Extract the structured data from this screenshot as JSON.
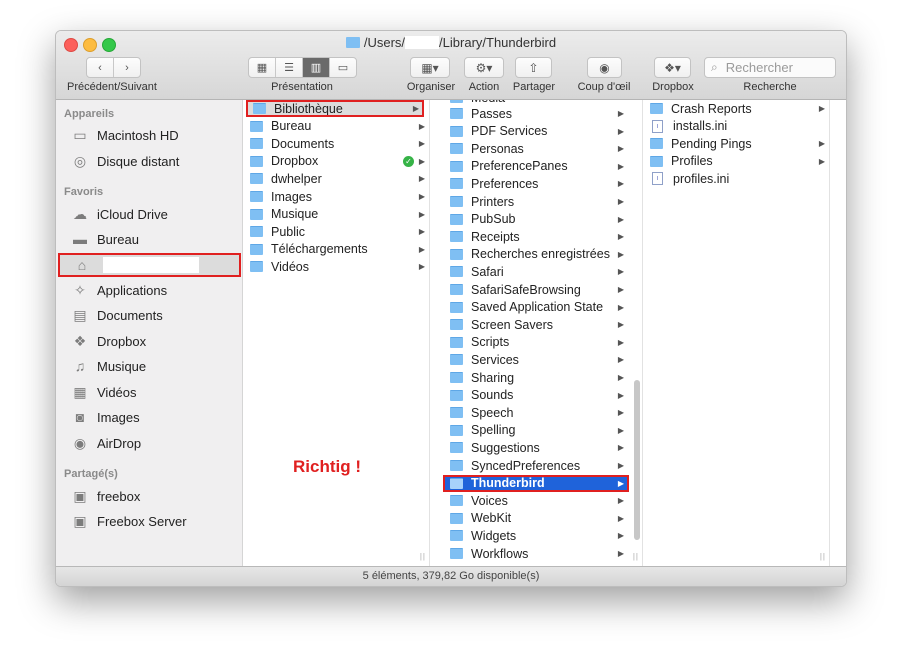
{
  "window": {
    "title_prefix": "/Users/",
    "title_suffix": "/Library/Thunderbird"
  },
  "toolbar": {
    "back_forward_label": "Précédent/Suivant",
    "view_label": "Présentation",
    "organize_label": "Organiser",
    "action_label": "Action",
    "share_label": "Partager",
    "quicklook_label": "Coup d'œil",
    "dropbox_label": "Dropbox",
    "search_label": "Recherche",
    "search_placeholder": "Rechercher"
  },
  "sidebar": {
    "sections": [
      {
        "title": "Appareils",
        "items": [
          {
            "label": "Macintosh HD",
            "icon": "hard-disk-icon"
          },
          {
            "label": "Disque distant",
            "icon": "disc-icon"
          }
        ]
      },
      {
        "title": "Favoris",
        "items": [
          {
            "label": "iCloud Drive",
            "icon": "cloud-icon"
          },
          {
            "label": "Bureau",
            "icon": "desktop-icon"
          },
          {
            "label": "",
            "icon": "home-icon"
          },
          {
            "label": "Applications",
            "icon": "applications-icon"
          },
          {
            "label": "Documents",
            "icon": "document-icon"
          },
          {
            "label": "Dropbox",
            "icon": "dropbox-icon"
          },
          {
            "label": "Musique",
            "icon": "music-icon"
          },
          {
            "label": "Vidéos",
            "icon": "film-icon"
          },
          {
            "label": "Images",
            "icon": "camera-icon"
          },
          {
            "label": "AirDrop",
            "icon": "airdrop-icon"
          }
        ]
      },
      {
        "title": "Partagé(s)",
        "items": [
          {
            "label": "freebox",
            "icon": "monitor-icon"
          },
          {
            "label": "Freebox Server",
            "icon": "monitor-icon"
          }
        ]
      }
    ]
  },
  "column1": [
    "Bibliothèque",
    "Bureau",
    "Documents",
    "Dropbox",
    "dwhelper",
    "Images",
    "Musique",
    "Public",
    "Téléchargements",
    "Vidéos"
  ],
  "column2": [
    "Passes",
    "PDF Services",
    "Personas",
    "PreferencePanes",
    "Preferences",
    "Printers",
    "PubSub",
    "Receipts",
    "Recherches enregistrées",
    "Safari",
    "SafariSafeBrowsing",
    "Saved Application State",
    "Screen Savers",
    "Scripts",
    "Services",
    "Sharing",
    "Sounds",
    "Speech",
    "Spelling",
    "Suggestions",
    "SyncedPreferences",
    "Thunderbird",
    "Voices",
    "WebKit",
    "Widgets",
    "Workflows"
  ],
  "column3": [
    {
      "label": "Crash Reports",
      "kind": "folder"
    },
    {
      "label": "installs.ini",
      "kind": "file"
    },
    {
      "label": "Pending Pings",
      "kind": "folder"
    },
    {
      "label": "Profiles",
      "kind": "folder"
    },
    {
      "label": "profiles.ini",
      "kind": "file"
    }
  ],
  "annotation": "Richtig !",
  "status": "5 éléments, 379,82 Go disponible(s)",
  "colors": {
    "selection_blue": "#1f63da",
    "annotation_red": "#e02020",
    "folder_blue": "#7fbff3"
  }
}
